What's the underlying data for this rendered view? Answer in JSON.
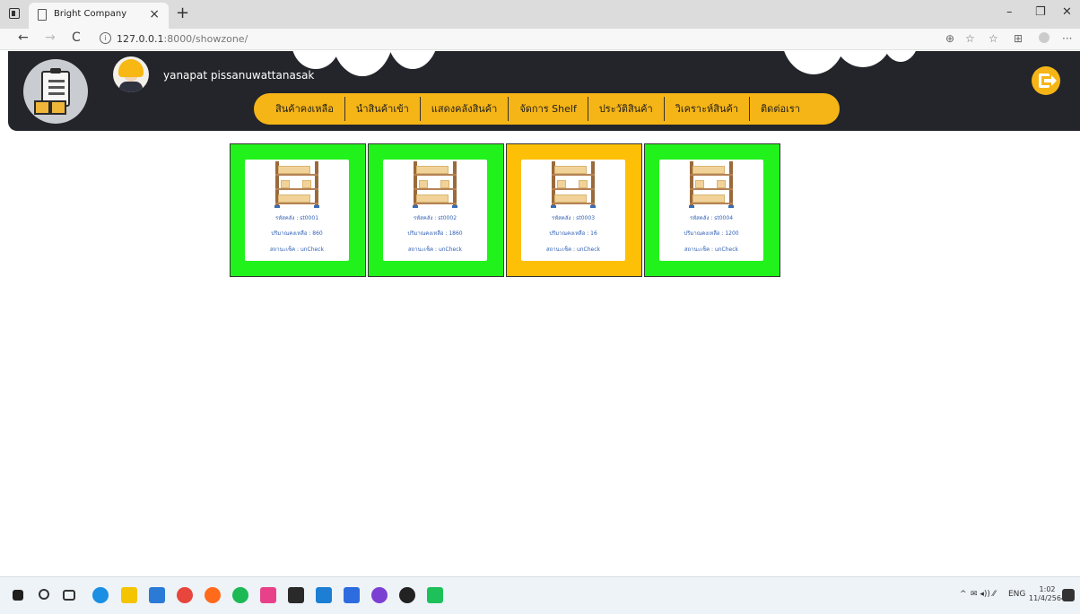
{
  "browser": {
    "tab_title": "Bright Company",
    "tab_close": "×",
    "tab_new": "+",
    "url_host": "127.0.0.1",
    "url_path": ":8000/showzone/",
    "info_glyph": "i",
    "back_glyph": "←",
    "forward_glyph": "→",
    "refresh_glyph": "C",
    "minimize_glyph": "–",
    "restore_glyph": "❐",
    "close_glyph": "✕",
    "more_glyph": "···"
  },
  "header": {
    "user_name": "yanapat pissanuwattanasak",
    "menu": [
      {
        "label": "สินค้าคงเหลือ"
      },
      {
        "label": "นำสินค้าเข้า"
      },
      {
        "label": "แสดงคลังสินค้า"
      },
      {
        "label": "จัดการ Shelf"
      },
      {
        "label": "ประวัติสินค้า"
      },
      {
        "label": "วิเคราะห์สินค้า"
      },
      {
        "label": "ติดต่อเรา"
      }
    ]
  },
  "zones": [
    {
      "code": "รหัสคลัง : st0001",
      "quantity": "ปริมาณคงเหลือ : 860",
      "status": "สถานะเช็ค : unCheck",
      "color": "#22f21c"
    },
    {
      "code": "รหัสคลัง : st0002",
      "quantity": "ปริมาณคงเหลือ : 1860",
      "status": "สถานะเช็ค : unCheck",
      "color": "#22f21c"
    },
    {
      "code": "รหัสคลัง : st0003",
      "quantity": "ปริมาณคงเหลือ : 16",
      "status": "สถานะเช็ค : unCheck",
      "color": "#fdc006"
    },
    {
      "code": "รหัสคลัง : st0004",
      "quantity": "ปริมาณคงเหลือ : 1200",
      "status": "สถานะเช็ค : unCheck",
      "color": "#22f21c"
    }
  ],
  "taskbar": {
    "tray_glyph": "^",
    "tray_icons": "✉ ◂)) ⁄⁄",
    "language": "ENG",
    "time": "1:02",
    "date": "11/4/2564"
  }
}
